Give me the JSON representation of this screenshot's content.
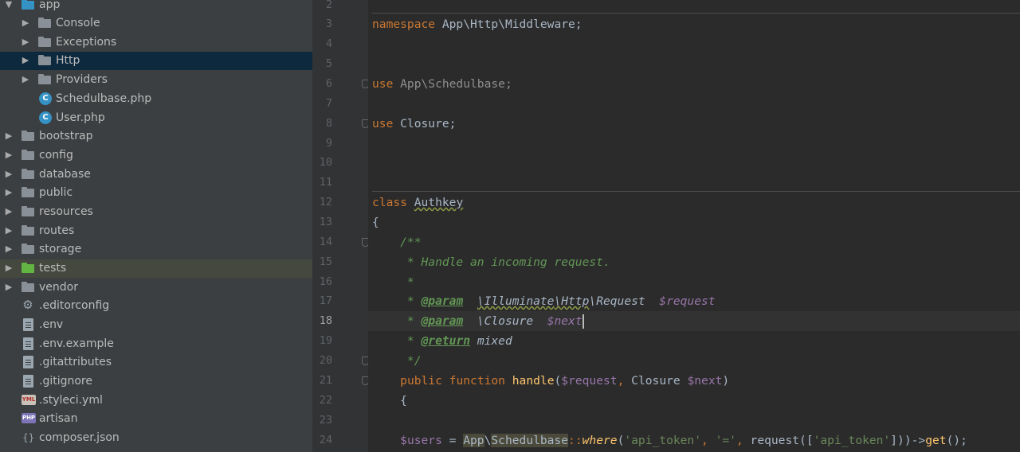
{
  "project_tree": {
    "items": [
      {
        "label": "app",
        "icon": "folder-icon",
        "expanded": true
      },
      {
        "label": "Console",
        "icon": "folder-icon"
      },
      {
        "label": "Exceptions",
        "icon": "folder-icon"
      },
      {
        "label": "Http",
        "icon": "folder-icon",
        "selected": true
      },
      {
        "label": "Providers",
        "icon": "folder-icon"
      },
      {
        "label": "Schedulbase.php",
        "icon": "php-class-icon"
      },
      {
        "label": "User.php",
        "icon": "php-class-icon"
      },
      {
        "label": "bootstrap",
        "icon": "folder-icon"
      },
      {
        "label": "config",
        "icon": "folder-icon"
      },
      {
        "label": "database",
        "icon": "folder-icon"
      },
      {
        "label": "public",
        "icon": "folder-icon"
      },
      {
        "label": "resources",
        "icon": "folder-icon"
      },
      {
        "label": "routes",
        "icon": "folder-icon"
      },
      {
        "label": "storage",
        "icon": "folder-icon"
      },
      {
        "label": "tests",
        "icon": "test-folder-icon"
      },
      {
        "label": "vendor",
        "icon": "folder-icon"
      },
      {
        "label": ".editorconfig",
        "icon": "gear-icon"
      },
      {
        "label": ".env",
        "icon": "text-file-icon"
      },
      {
        "label": ".env.example",
        "icon": "text-file-icon"
      },
      {
        "label": ".gitattributes",
        "icon": "text-file-icon"
      },
      {
        "label": ".gitignore",
        "icon": "gitignore-file-icon"
      },
      {
        "label": ".styleci.yml",
        "icon": "yml-file-icon"
      },
      {
        "label": "artisan",
        "icon": "php-file-icon"
      },
      {
        "label": "composer.json",
        "icon": "json-file-icon"
      }
    ],
    "icon_badges": {
      "class": "C",
      "yml": "YML",
      "php": "PHP",
      "json": "{}"
    }
  },
  "editor": {
    "current_line": 18,
    "line_numbers": [
      "2",
      "3",
      "4",
      "5",
      "6",
      "7",
      "8",
      "9",
      "10",
      "11",
      "12",
      "13",
      "14",
      "15",
      "16",
      "17",
      "18",
      "19",
      "20",
      "21",
      "22",
      "23",
      "24"
    ],
    "code": {
      "l3_kw": "namespace",
      "l3_rest": " App\\Http\\Middleware;",
      "l6_kw": "use",
      "l6_rest": " App\\Schedulbase;",
      "l8_kw": "use",
      "l8_rest": " Closure;",
      "l12_kw": "class",
      "l12_name": "Authkey",
      "l13": "{",
      "l14": "    /**",
      "l15": "     * Handle an incoming request.",
      "l16": "     *",
      "l17_star": "     * ",
      "l17_tag": "@param",
      "l17_ns1": "\\Illuminate",
      "l17_ns2": "\\Http",
      "l17_type": "\\Request",
      "l17_var": "$request",
      "l18_star": "     * ",
      "l18_tag": "@param",
      "l18_type": "\\Closure",
      "l18_var": "$next",
      "l19_star": "     * ",
      "l19_tag": "@return",
      "l19_type": "mixed",
      "l20": "     */",
      "l21_public": "public",
      "l21_function": "function",
      "l21_name": "handle",
      "l21_open": "(",
      "l21_var1": "$request",
      "l21_comma": ",",
      "l21_type": "Closure",
      "l21_var2": "$next",
      "l21_close": ")",
      "l22": "    {",
      "l24_var": "$users",
      "l24_eq": " = ",
      "l24_ns": "App",
      "l24_bs": "\\",
      "l24_cls": "Schedulbase",
      "l24_colons": "::",
      "l24_where": "where",
      "l24_p1": "(",
      "l24_s1": "'api_token'",
      "l24_c1": ", ",
      "l24_s2": "'='",
      "l24_c2": ", ",
      "l24_req": "request([",
      "l24_s3": "'api_token'",
      "l24_close": "]))->",
      "l24_get": "get",
      "l24_end": "();"
    }
  },
  "colors": {
    "tree_bg": "#3c3f41",
    "selection": "#0d293e",
    "editor_bg": "#2b2b2b",
    "keyword": "#cc7832",
    "string": "#6a8759",
    "comment": "#629755",
    "variable": "#9876aa",
    "function": "#ffc66d"
  }
}
